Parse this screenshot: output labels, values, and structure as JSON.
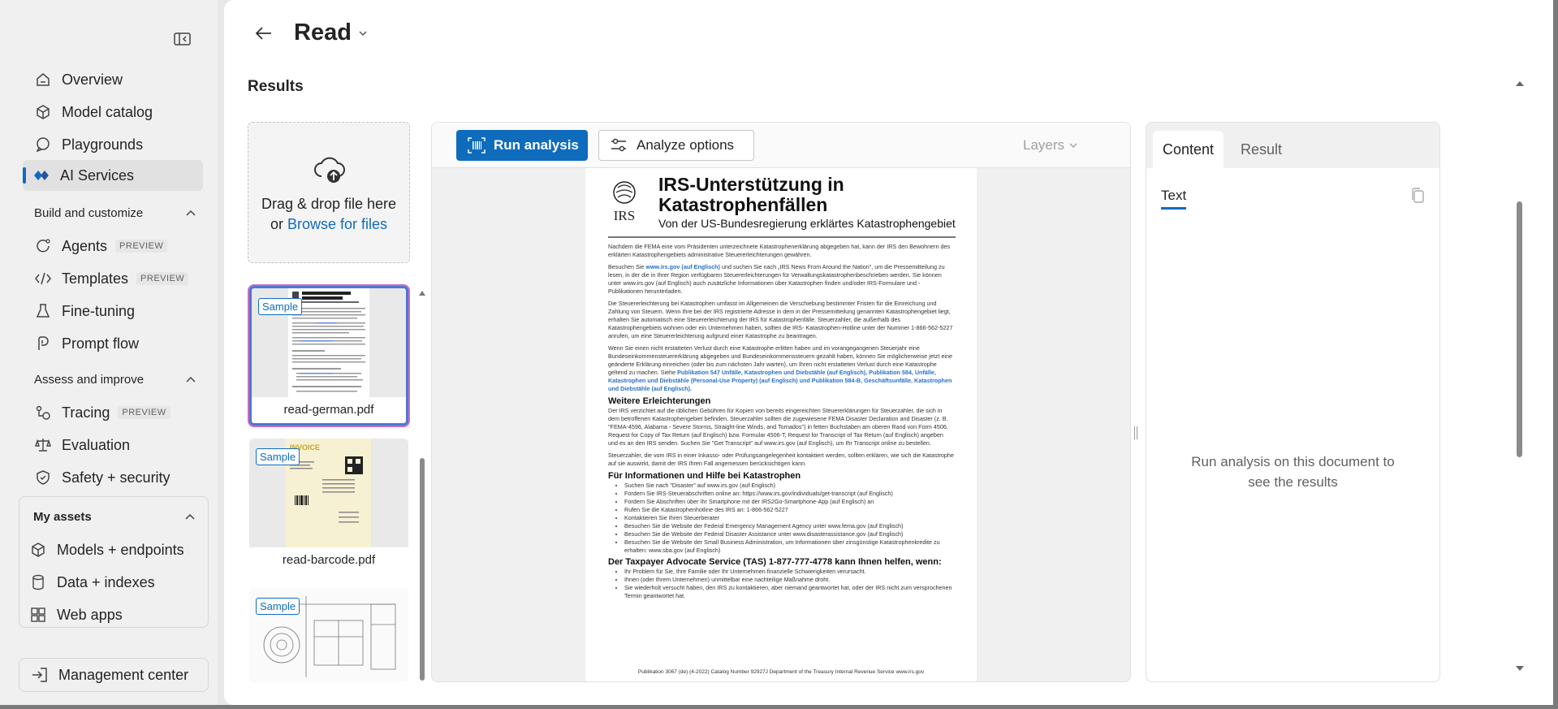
{
  "sidebar": {
    "items": [
      {
        "label": "Overview",
        "icon": "home-icon"
      },
      {
        "label": "Model catalog",
        "icon": "cube-icon"
      },
      {
        "label": "Playgrounds",
        "icon": "chat-icon"
      },
      {
        "label": "AI Services",
        "icon": "ai-services-icon",
        "active": true
      }
    ],
    "build_section": "Build and customize",
    "build_items": [
      {
        "label": "Agents",
        "badge": "PREVIEW"
      },
      {
        "label": "Templates",
        "badge": "PREVIEW"
      },
      {
        "label": "Fine-tuning"
      },
      {
        "label": "Prompt flow"
      }
    ],
    "assess_section": "Assess and improve",
    "assess_items": [
      {
        "label": "Tracing",
        "badge": "PREVIEW"
      },
      {
        "label": "Evaluation"
      },
      {
        "label": "Safety + security"
      }
    ],
    "assets_section": "My assets",
    "assets_items": [
      {
        "label": "Models + endpoints"
      },
      {
        "label": "Data + indexes"
      },
      {
        "label": "Web apps"
      }
    ],
    "management": "Management center"
  },
  "header": {
    "title": "Read",
    "results": "Results"
  },
  "dropzone": {
    "line1": "Drag & drop file here",
    "or": "or",
    "browse": "Browse for files"
  },
  "samples": [
    {
      "tag": "Sample",
      "name": "read-german.pdf"
    },
    {
      "tag": "Sample",
      "name": "read-barcode.pdf"
    },
    {
      "tag": "Sample",
      "name": ""
    }
  ],
  "toolbar": {
    "run": "Run analysis",
    "options": "Analyze options",
    "layers": "Layers"
  },
  "document": {
    "logo": "IRS",
    "title": "IRS-Unterstützung in Katastrophenfällen",
    "subtitle": "Von der US-Bundesregierung erklärtes Katastrophengebiet",
    "p1": "Nachdem die FEMA eine vom Präsidenten unterzeichnete Katastrophenerklärung abgegeben hat, kann der IRS den Bewohnern des erklärten Katastrophengebiets administrative Steuererleichterungen gewähren.",
    "p2a": "Besuchen Sie ",
    "p2link": "www.irs.gov (auf Englisch)",
    "p2b": " und suchen Sie nach „IRS News From Around the Nation\", um die Pressemitteilung zu lesen, in der die in Ihrer Region verfügbaren Steuererleichterungen für Verwaltungskatastrophenbeschrieben werden. Sie können unter www.irs.gov (auf Englisch) auch zusätzliche Informationen über Katastrophen finden und/oder IRS-Formulare und -Publikationen herunterladen.",
    "p3": "Die Steuererleichterung bei Katastrophen umfasst im Allgemeinen die Verschiebung bestimmter Fristen für die Einreichung und Zahlung von Steuern. Wenn Ihre bei der IRS registrierte Adresse in dem in der Pressemitteilung genannten Katastrophengebiet liegt, erhalten Sie automatisch eine Steuererleichterung der IRS für Katastrophenfälle. Steuerzahler, die außerhalb des Katastrophengebiets wohnen oder ein Unternehmen haben, sollten die IRS- Katastrophen-Hotline unter der Nummer 1-866-562-5227 anrufen, um eine Steuererleichterung aufgrund einer Katastrophe zu beantragen.",
    "p4a": "Wenn Sie einen nicht erstatteten Verlust durch eine Katastrophe erlitten haben und im vorangegangenen Steuerjahr eine Bundeseinkommensteuererklärung abgegeben und Bundeseinkommenssteuern gezahlt haben, können Sie möglicherweise jetzt eine geänderte Erklärung einreichen (oder bis zum nächsten Jahr warten), um Ihren nicht erstatteten Verlust durch eine Katastrophe geltend zu machen. Siehe ",
    "p4link": "Publikation 547 Unfälle, Katastrophen und Diebstähle (auf Englisch), Publikation 584, Unfälle, Katastrophen und Diebstähle (Personal-Use Property) (auf Englisch) und Publikation 584-B, Geschäftsunfälle, Katastrophen und Diebstähle (auf Englisch).",
    "h1": "Weitere Erleichterungen",
    "p5": "Der IRS verzichtet auf die üblichen Gebühren für Kopien von bereits eingereichten Steuererklärungen für Steuerzahler, die sich in dem betroffenen Katastrophengebiet befinden. Steuerzahler sollten die zugewiesene FEMA Disaster Declaration and Disaster (z. B. \"FEMA-4596, Alabama - Severe Storms, Straight-line Winds, and Tornados\") in fetten Buchstaben am oberen Rand von Form 4506, Request for Copy of Tax Return (auf Englisch) bzw. Formular 4506-T, Request for Transcript of Tax Return (auf Englisch) angeben und es an den IRS senden. Suchen Sie \"Get Transcript\" auf www.irs.gov (auf Englisch), um Ihr Transcript online zu bestellen.",
    "p6": "Steuerzahler, die vom IRS in einer Inkasso- oder Prüfungsangelegenheit kontaktiert werden, sollten erklären, wie sich die Katastrophe auf sie auswirkt, damit der IRS Ihren Fall angemessen berücksichtigen kann.",
    "h2": "Für Informationen und Hilfe bei Katastrophen",
    "list1": [
      "Suchen Sie nach \"Disaster\" auf www.irs.gov (auf Englisch)",
      "Fordern Sie IRS-Steuerabschriften online an: https://www.irs.gov/individuals/get-transcript (auf Englisch)",
      "Fordern Sie Abschriften über Ihr Smartphone mit der IRS2Go-Smartphone-App (auf Englisch) an",
      "Rufen Sie die Katastrophenhotline des IRS an: 1-866-562-5227",
      "Kontaktieren Sie Ihren Steuerberater",
      "Besuchen Sie die Website der Federal Emergency Management Agency unter www.fema.gov (auf Englisch)",
      "Besuchen Sie die Website der Federal Disaster Assistance unter www.disasterassistance.gov (auf Englisch)",
      "Besuchen Sie die Website der Small Business Administration, um Informationen über zinsgünstige Katastrophenkredite zu erhalten: www.sba.gov (auf Englisch)"
    ],
    "h3": "Der Taxpayer Advocate Service (TAS) 1-877-777-4778 kann Ihnen helfen, wenn:",
    "list2": [
      "Ihr Problem für Sie, Ihre Familie oder Ihr Unternehmen finanzielle Schwierigkeiten verursacht.",
      "Ihnen (oder Ihrem Unternehmen) unmittelbar eine nachteilige Maßnahme droht.",
      "Sie wiederholt versucht haben, den IRS zu kontaktieren, aber niemand geantwortet hat, oder der IRS nicht zum versprochenen Termin geantwortet hat."
    ],
    "footer": "Publikation 3067 (de) (4-2022) Catalog Number 92927J Department of the Treasury Internal Revenue Service www.irs.gov"
  },
  "right_panel": {
    "tabs": [
      "Content",
      "Result"
    ],
    "sub_tab": "Text",
    "empty": "Run analysis on this document to see the results"
  },
  "colors": {
    "accent": "#0f6cbd",
    "selected_border": "#4b78d6",
    "selected_glow": "#c76ec4"
  }
}
